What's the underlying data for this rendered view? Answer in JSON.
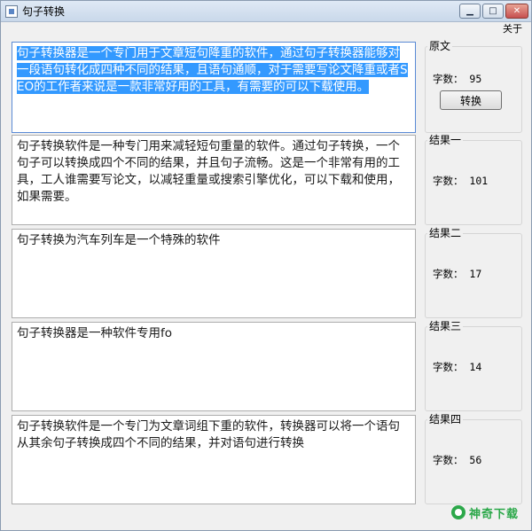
{
  "window": {
    "title": "句子转换",
    "buttons": {
      "minimize": "▁",
      "maximize": "□",
      "close": "✕"
    }
  },
  "menu": {
    "about": "关于"
  },
  "original": {
    "text": "句子转换器是一个专门用于文章短句降重的软件，通过句子转换器能够对一段语句转化成四种不同的结果，且语句通顺，对于需要写论文降重或者SEO的工作者来说是一款非常好用的工具，有需要的可以下载使用。",
    "group_label": "原文",
    "count_label": "字数： 95",
    "convert_button": "转换"
  },
  "results": [
    {
      "group_label": "结果一",
      "count_label": "字数： 101",
      "text": "句子转换软件是一种专门用来减轻短句重量的软件。通过句子转换，一个句子可以转换成四个不同的结果，并且句子流畅。这是一个非常有用的工具，工人谁需要写论文，以减轻重量或搜索引擎优化，可以下载和使用，如果需要。"
    },
    {
      "group_label": "结果二",
      "count_label": "字数： 17",
      "text": "句子转换为汽车列车是一个特殊的软件"
    },
    {
      "group_label": "结果三",
      "count_label": "字数： 14",
      "text": "句子转换器是一种软件专用fo"
    },
    {
      "group_label": "结果四",
      "count_label": "字数： 56",
      "text": "句子转换软件是一个专门为文章词组下重的软件，转换器可以将一个语句从其余句子转换成四个不同的结果，并对语句进行转换"
    }
  ],
  "watermark": {
    "text": "神奇下载"
  },
  "colors": {
    "selection": "#3399ff",
    "watermark": "#2ca84a"
  }
}
